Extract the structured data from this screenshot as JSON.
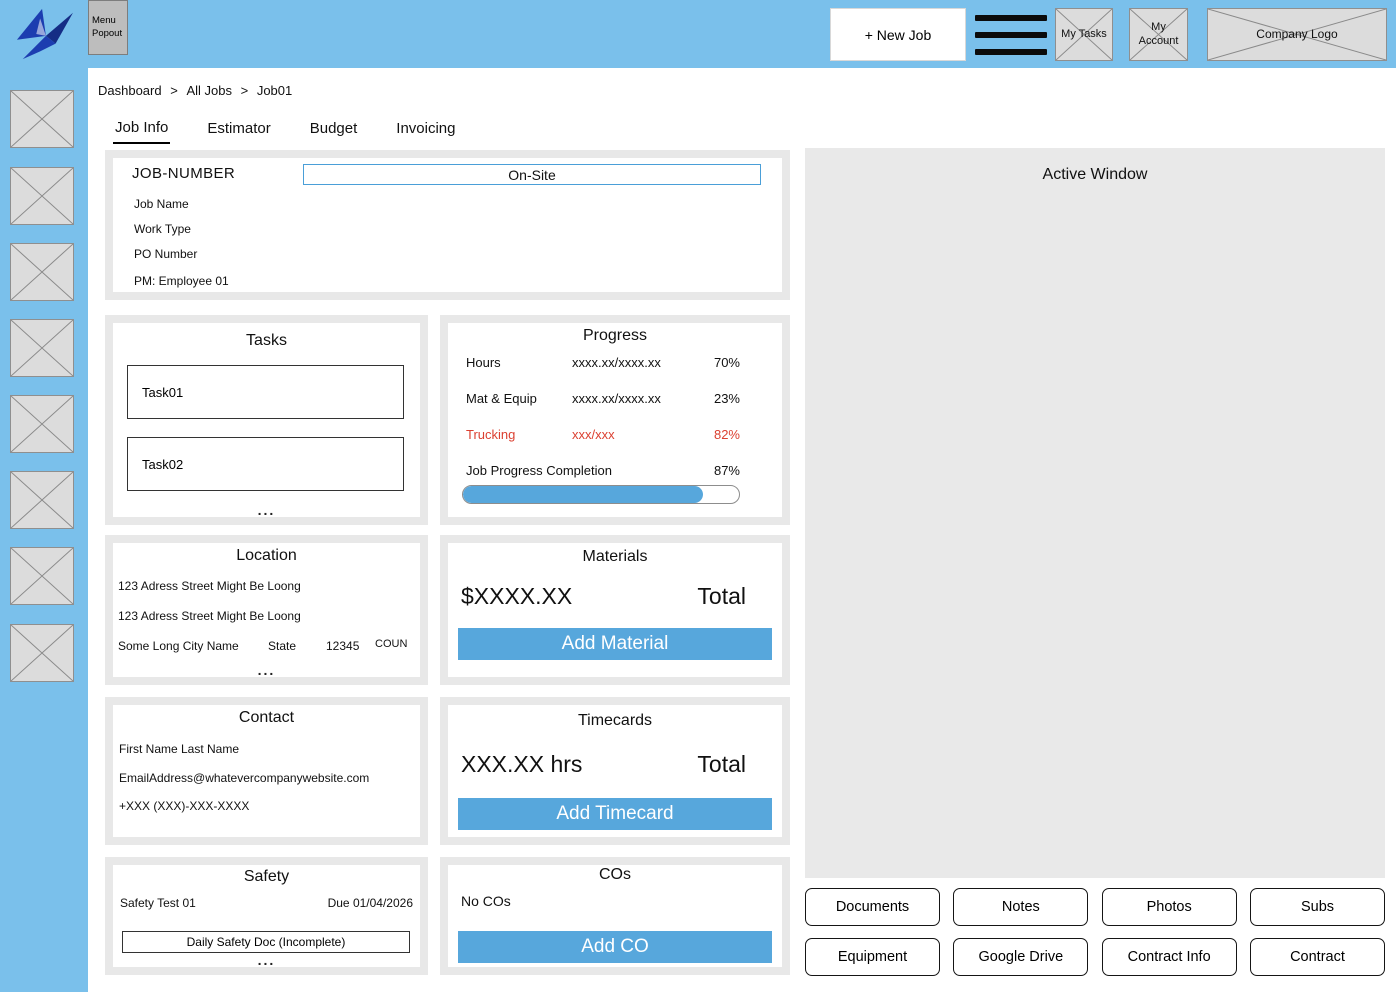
{
  "colors": {
    "header_blue": "#7AC0EB",
    "accent_blue": "#57A7DC",
    "alert_red": "#DB4031"
  },
  "header": {
    "menu_popout_label": "Menu Popout",
    "new_job_label": "+ New Job",
    "my_tasks_label": "My Tasks",
    "my_account_label": "My Account",
    "company_logo_label": "Company Logo"
  },
  "breadcrumb": {
    "items": [
      "Dashboard",
      "All Jobs",
      "Job01"
    ],
    "separator": ">"
  },
  "tabs": [
    "Job Info",
    "Estimator",
    "Budget",
    "Invoicing"
  ],
  "job_header": {
    "job_number_label": "JOB-NUMBER",
    "status_value": "On-Site",
    "job_name_label": "Job Name",
    "work_type_label": "Work Type",
    "po_number_label": "PO Number",
    "pm_label": "PM: Employee 01"
  },
  "tasks": {
    "title": "Tasks",
    "items": [
      "Task01",
      "Task02"
    ],
    "more": "..."
  },
  "progress": {
    "title": "Progress",
    "rows": [
      {
        "label": "Hours",
        "value": "xxxx.xx/xxxx.xx",
        "pct": "70%"
      },
      {
        "label": "Mat & Equip",
        "value": "xxxx.xx/xxxx.xx",
        "pct": "23%"
      },
      {
        "label": "Trucking",
        "value": "xxx/xxx",
        "pct": "82%"
      }
    ],
    "completion_label": "Job Progress Completion",
    "completion_pct": "87%",
    "completion_value": 87
  },
  "location": {
    "title": "Location",
    "address_line1": "123 Adress Street Might Be Loong",
    "address_line2": "123 Adress Street Might Be Loong",
    "city": "Some Long City Name",
    "state": "State",
    "zip": "12345",
    "country": "COUN",
    "more": "..."
  },
  "materials": {
    "title": "Materials",
    "amount": "$XXXX.XX",
    "total_label": "Total",
    "add_label": "Add Material"
  },
  "contact": {
    "title": "Contact",
    "name": "First Name Last Name",
    "email": "EmailAddress@whatevercompanywebsite.com",
    "phone": "+XXX (XXX)-XXX-XXXX"
  },
  "timecards": {
    "title": "Timecards",
    "amount": "XXX.XX hrs",
    "total_label": "Total",
    "add_label": "Add Timecard"
  },
  "safety": {
    "title": "Safety",
    "item": "Safety Test 01",
    "due": "Due 01/04/2026",
    "doc_label": "Daily Safety Doc (Incomplete)",
    "more": "..."
  },
  "cos": {
    "title": "COs",
    "empty_label": "No COs",
    "add_label": "Add CO"
  },
  "active_window": {
    "title": "Active Window"
  },
  "action_buttons": [
    "Documents",
    "Notes",
    "Photos",
    "Subs",
    "Equipment",
    "Google Drive",
    "Contract Info",
    "Contract"
  ]
}
